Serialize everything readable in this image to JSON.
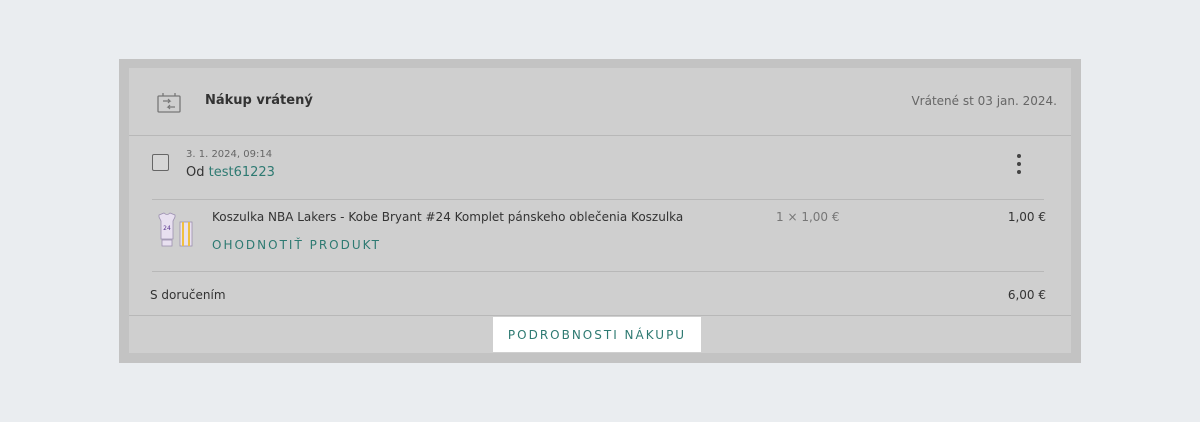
{
  "order": {
    "status_title": "Nákup vrátený",
    "status_date": "Vrátené st 03 jan. 2024.",
    "datetime": "3. 1. 2024, 09:14",
    "from_label": "Od",
    "from_user": "test61223"
  },
  "product": {
    "name": "Koszulka NBA Lakers - Kobe Bryant #24 Komplet pánskeho oblečenia Koszulka",
    "quantity_price": "1 × 1,00 €",
    "total": "1,00 €",
    "rate_label": "OHODNOTIŤ PRODUKT",
    "jersey_number": "24"
  },
  "summary": {
    "shipping_label": "S doručením",
    "shipping_total": "6,00 €"
  },
  "actions": {
    "details_label": "PODROBNOSTI NÁKUPU"
  },
  "icons": {
    "return": "return-arrows-icon",
    "menu": "kebab-menu-icon"
  },
  "colors": {
    "accent": "#2e7a72",
    "page_background": "#eaedf0",
    "card_background": "#cfcfcf"
  }
}
